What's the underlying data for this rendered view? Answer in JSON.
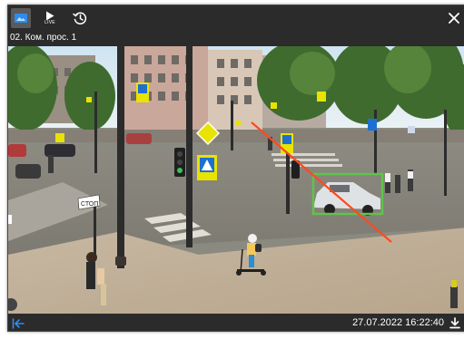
{
  "toolbar": {
    "photo_icon": "image-icon",
    "live_label": "LIVE",
    "history_icon": "history-icon",
    "close_icon": "close-icon"
  },
  "camera": {
    "title": "02. Ком. прос. 1"
  },
  "scene": {
    "stop_sign_text": "СТОП",
    "detection_box_color": "#5ec44a",
    "trajectory_line_color": "#ff4a1e"
  },
  "footer": {
    "back_icon": "arrow-left-icon",
    "timestamp": "27.07.2022 16:22:40",
    "download_icon": "download-icon",
    "accent_color": "#2d8cf0"
  }
}
